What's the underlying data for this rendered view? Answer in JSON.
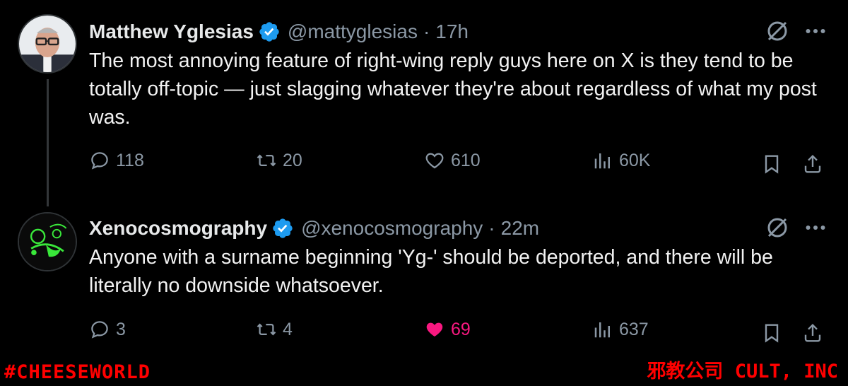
{
  "tweets": [
    {
      "display_name": "Matthew Yglesias",
      "handle": "@mattyglesias",
      "separator": "·",
      "time": "17h",
      "text": "The most annoying feature of right-wing reply guys here on X is they tend to be totally off-topic — just slagging whatever they're about regardless of what my post was.",
      "replies": "118",
      "reposts": "20",
      "likes": "610",
      "views": "60K",
      "liked": false
    },
    {
      "display_name": "Xenocosmography",
      "handle": "@xenocosmography",
      "separator": "·",
      "time": "22m",
      "text": "Anyone with a surname beginning 'Yg-' should be deported, and there will be literally no downside whatsoever.",
      "replies": "3",
      "reposts": "4",
      "likes": "69",
      "views": "637",
      "liked": true
    }
  ],
  "watermarks": {
    "left": "#CHEESEWORLD",
    "right": "邪教公司 CULT, INC"
  },
  "colors": {
    "background": "#000000",
    "text": "#e7e9ea",
    "muted": "#8b98a5",
    "verified": "#1d9bf0",
    "like": "#f91880",
    "watermark": "#ff0000"
  }
}
